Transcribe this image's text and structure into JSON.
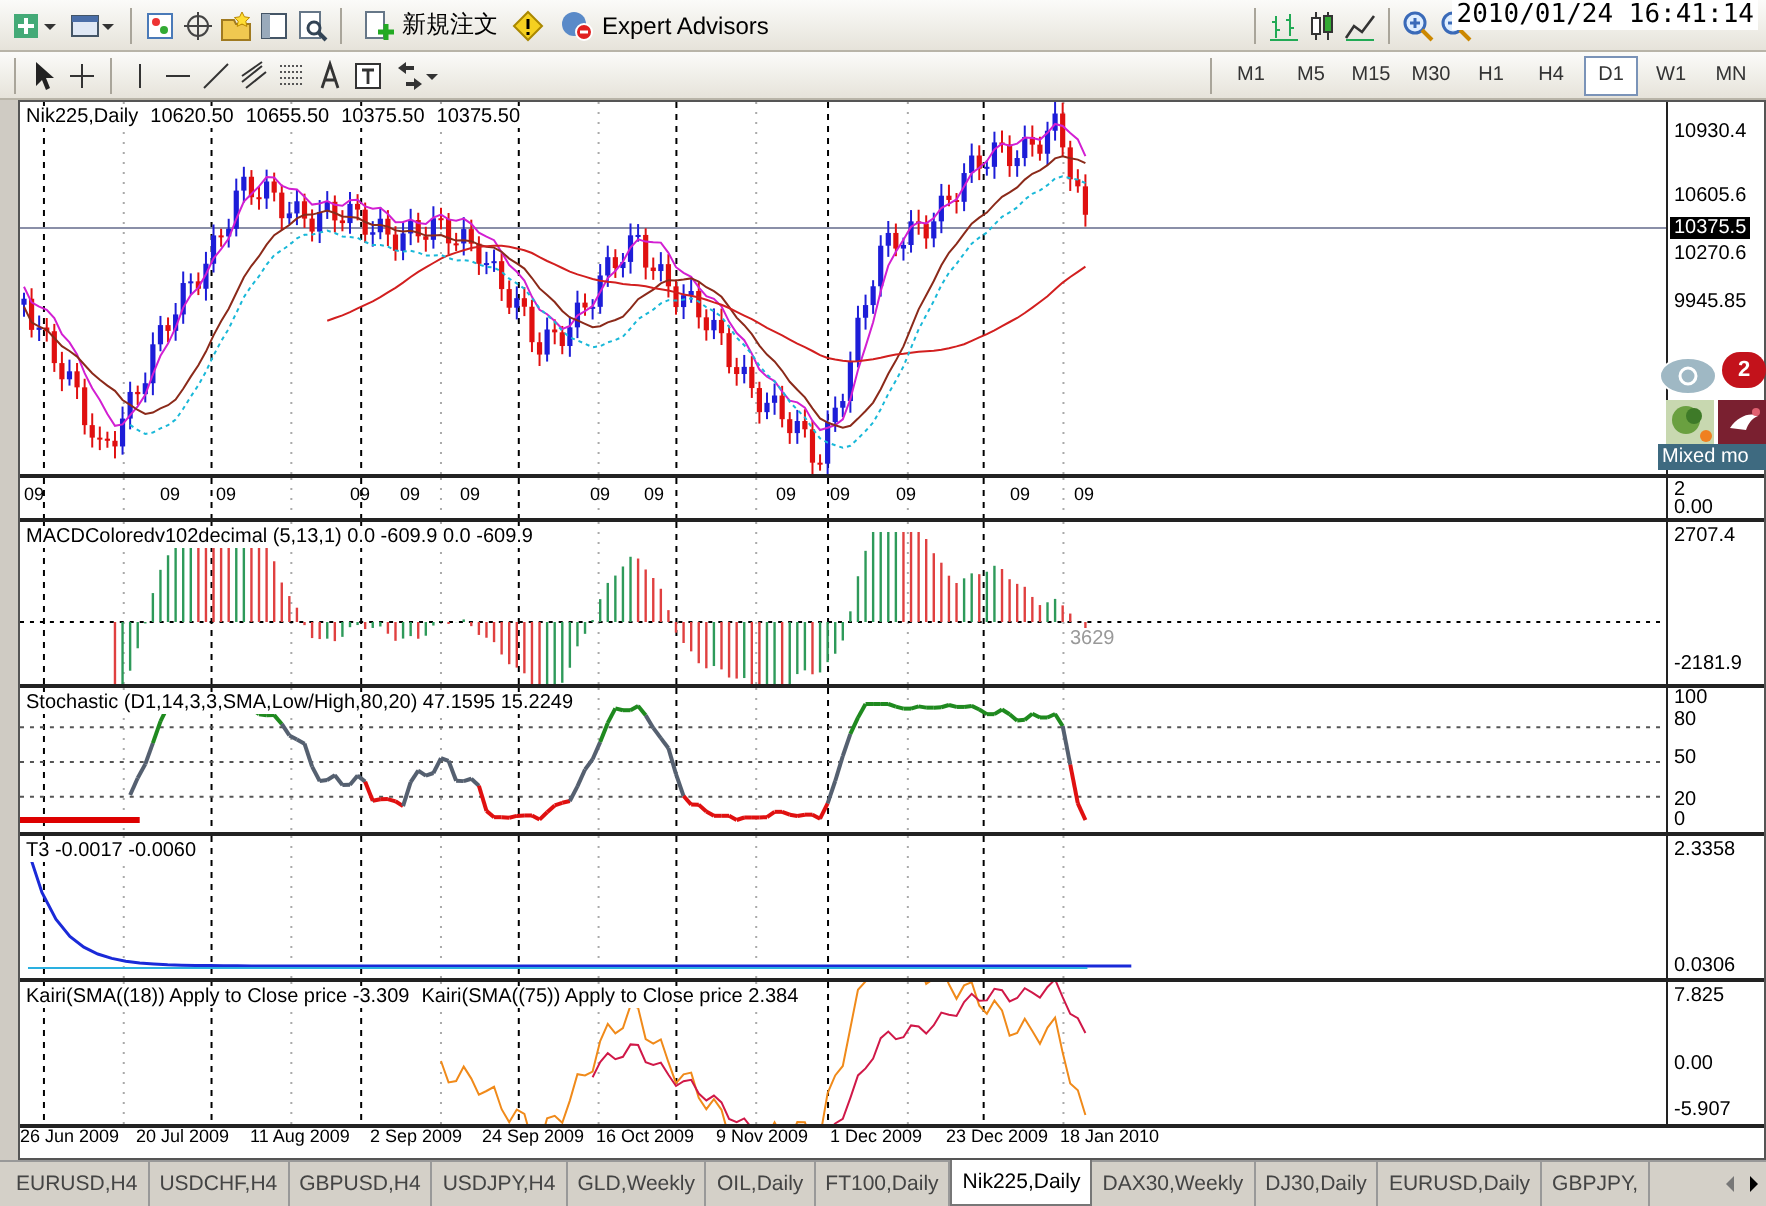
{
  "toolbar": {
    "buttons": [
      {
        "label": "新規注文"
      },
      {
        "label": "Expert Advisors"
      }
    ]
  },
  "clock": "2010/01/24 16:41:14",
  "timeframes": [
    {
      "label": "M1",
      "selected": false
    },
    {
      "label": "M5",
      "selected": false
    },
    {
      "label": "M15",
      "selected": false
    },
    {
      "label": "M30",
      "selected": false
    },
    {
      "label": "H1",
      "selected": false
    },
    {
      "label": "H4",
      "selected": false
    },
    {
      "label": "D1",
      "selected": true
    },
    {
      "label": "W1",
      "selected": false
    },
    {
      "label": "MN",
      "selected": false
    }
  ],
  "main_pane": {
    "symbol": "Nik225,Daily",
    "ohlc": [
      "10620.50",
      "10655.50",
      "10375.50",
      "10375.50"
    ],
    "axis": [
      "10930.4",
      "10605.6",
      "10270.6",
      "9945.85"
    ],
    "current_price": "10375.5"
  },
  "date_strip": {
    "labels": [
      "09",
      "09",
      "09",
      "09",
      "09",
      "09",
      "09",
      "09",
      "09",
      "09",
      "09",
      "09",
      "09"
    ],
    "axis": [
      "2",
      "0.00"
    ]
  },
  "indicators": [
    {
      "kind": "macd",
      "label": "MACDColoredv102decimal (5,13,1) 0.0 -609.9 0.0 -609.9",
      "axis": [
        "2707.4",
        "-2181.9"
      ],
      "value_text": "3629"
    },
    {
      "kind": "stochastic",
      "label": "Stochastic (D1,14,3,3,SMA,Low/High,80,20) 47.1595 15.2249",
      "axis": [
        "100",
        "80",
        "50",
        "20",
        "0"
      ]
    },
    {
      "kind": "t3",
      "label": "T3 -0.0017 -0.0060",
      "axis": [
        "2.3358",
        "0.0306"
      ]
    },
    {
      "kind": "kairi",
      "labels": [
        "Kairi(SMA((18)) Apply to Close price -3.309",
        "Kairi(SMA((75)) Apply to Close price 2.384"
      ],
      "axis": [
        "7.825",
        "0.00",
        "-5.907"
      ]
    }
  ],
  "dates": [
    "26 Jun 2009",
    "20 Jul 2009",
    "11 Aug 2009",
    "2 Sep 2009",
    "24 Sep 2009",
    "16 Oct 2009",
    "9 Nov 2009",
    "1 Dec 2009",
    "23 Dec 2009",
    "18 Jan 2010"
  ],
  "widget": {
    "badge": "2",
    "label": "Mixed mo"
  },
  "tabs": [
    {
      "label": "EURUSD,H4",
      "selected": false
    },
    {
      "label": "USDCHF,H4",
      "selected": false
    },
    {
      "label": "GBPUSD,H4",
      "selected": false
    },
    {
      "label": "USDJPY,H4",
      "selected": false
    },
    {
      "label": "GLD,Weekly",
      "selected": false
    },
    {
      "label": "OIL,Daily",
      "selected": false
    },
    {
      "label": "FT100,Daily",
      "selected": false
    },
    {
      "label": "Nik225,Daily",
      "selected": true
    },
    {
      "label": "DAX30,Weekly",
      "selected": false
    },
    {
      "label": "DJ30,Daily",
      "selected": false
    },
    {
      "label": "EURUSD,Daily",
      "selected": false
    },
    {
      "label": "GBPJPY,",
      "selected": false
    }
  ]
}
